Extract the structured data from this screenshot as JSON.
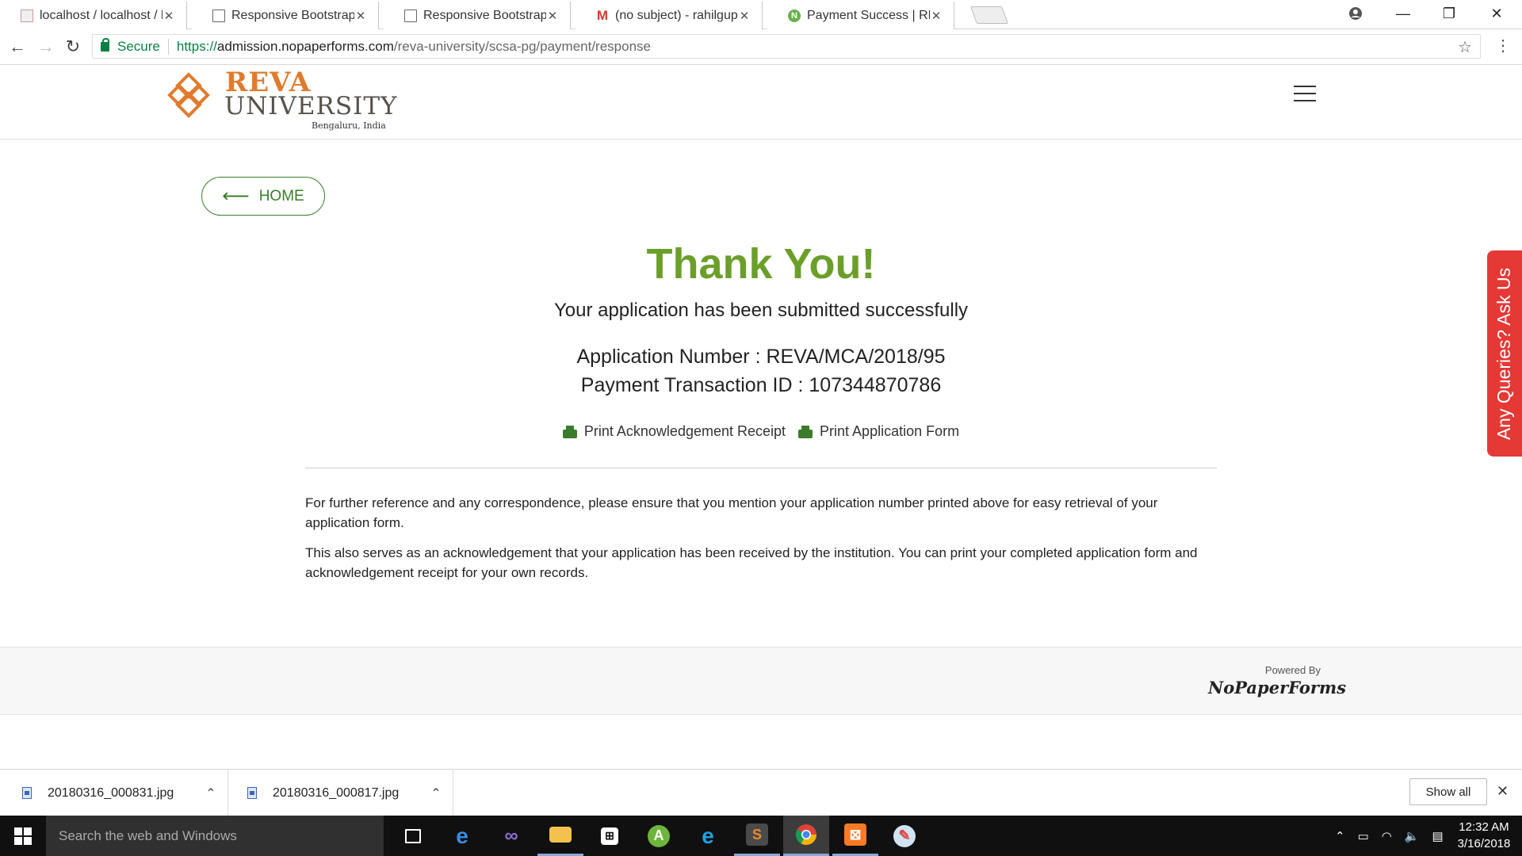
{
  "browser": {
    "tabs": [
      {
        "title": "localhost / localhost / bp",
        "favicon": "phpmyadmin-icon"
      },
      {
        "title": "Responsive Bootstrap Ad",
        "favicon": "document-icon"
      },
      {
        "title": "Responsive Bootstrap Ad",
        "favicon": "document-icon"
      },
      {
        "title": "(no subject) - rahilgupta",
        "favicon": "gmail-icon"
      },
      {
        "title": "Payment Success | REVA",
        "favicon": "nopaperforms-icon",
        "active": true
      }
    ],
    "secure_label": "Secure",
    "url_scheme_host": "https://",
    "url_domain": "admission.nopaperforms.com",
    "url_path": "/reva-university/scsa-pg/payment/response"
  },
  "site": {
    "logo_word1": "REVA",
    "logo_word2": "UNIVERSITY",
    "logo_tagline": "Bengaluru, India",
    "brand_color": "#e07b2e"
  },
  "main": {
    "home_label": "HOME",
    "thank_you": "Thank You!",
    "submitted_text": "Your application has been submitted successfully",
    "application_number_line": "Application Number : REVA/MCA/2018/95",
    "transaction_id_line": "Payment Transaction ID : 107344870786",
    "print_receipt_label": "Print Acknowledgement Receipt",
    "print_form_label": "Print Application Form",
    "note_1": "For further reference and any correspondence, please ensure that you mention your application number printed above for easy retrieval of your application form.",
    "note_2": "This also serves as an acknowledgement that your application has been received by the institution. You can print your completed application form and acknowledgement receipt for your own records.",
    "accent_color": "#6b9f2a"
  },
  "footer": {
    "powered_by": "Powered By",
    "brand": "NoPaperForms"
  },
  "side_tab": {
    "label": "Any Queries? Ask Us",
    "color": "#e53935"
  },
  "downloads": {
    "items": [
      "20180316_000831.jpg",
      "20180316_000817.jpg"
    ],
    "show_all_label": "Show all"
  },
  "taskbar": {
    "search_placeholder": "Search the web and Windows",
    "time": "12:32 AM",
    "date": "3/16/2018"
  }
}
